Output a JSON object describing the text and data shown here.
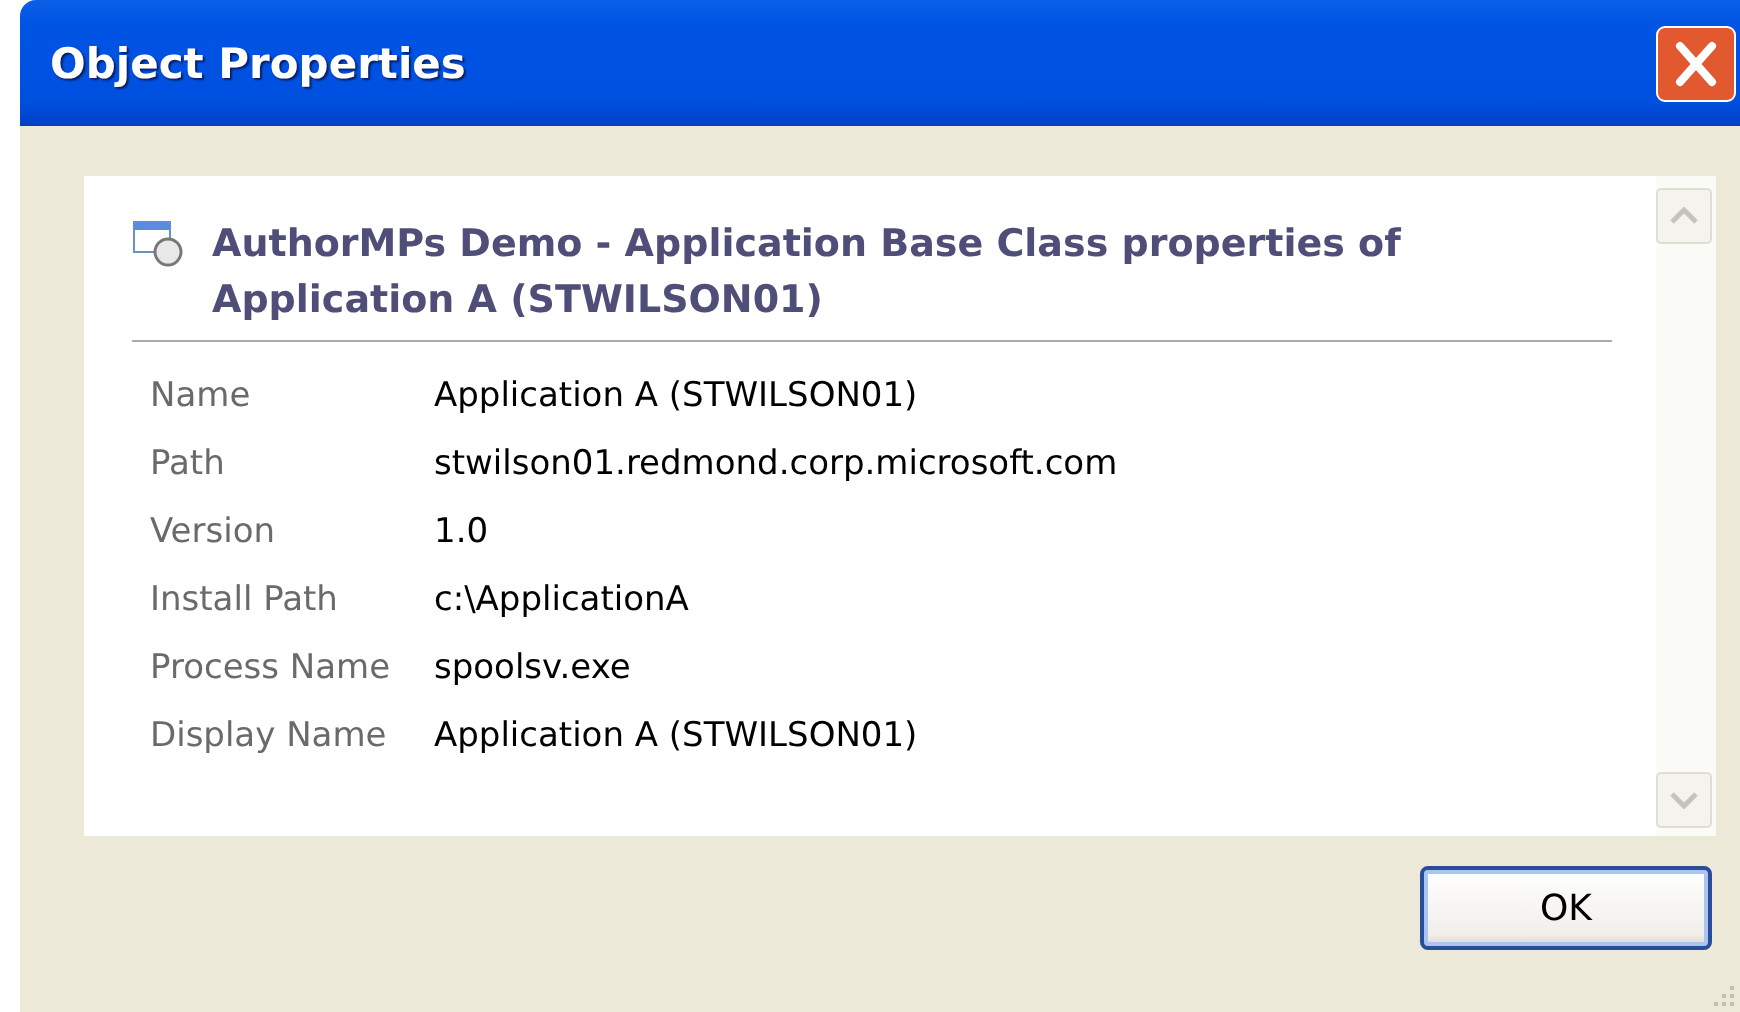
{
  "window": {
    "title": "Object Properties"
  },
  "heading": "AuthorMPs Demo - Application Base Class properties of Application A (STWILSON01)",
  "properties": [
    {
      "label": "Name",
      "value": "Application A (STWILSON01)"
    },
    {
      "label": "Path",
      "value": "stwilson01.redmond.corp.microsoft.com"
    },
    {
      "label": "Version",
      "value": "1.0"
    },
    {
      "label": "Install Path",
      "value": "c:\\ApplicationA"
    },
    {
      "label": "Process Name",
      "value": "spoolsv.exe"
    },
    {
      "label": "Display Name",
      "value": "Application A (STWILSON01)"
    }
  ],
  "buttons": [
    "OK"
  ]
}
